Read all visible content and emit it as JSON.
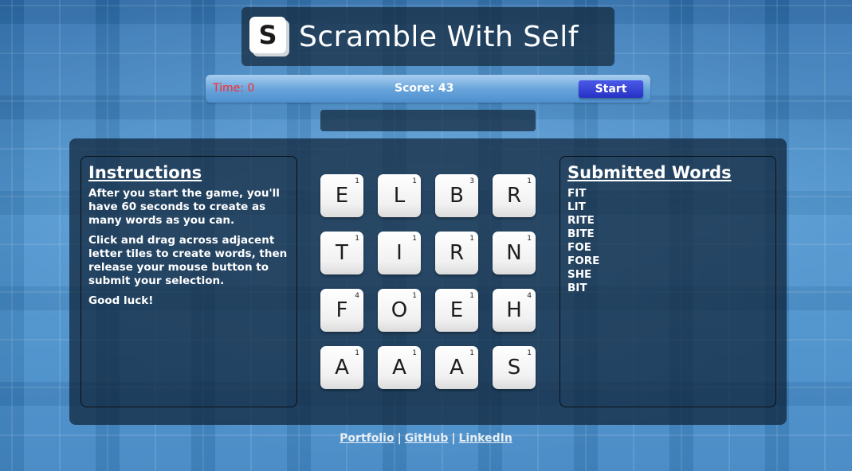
{
  "header": {
    "logo_letter": "S",
    "title": "Scramble With Self"
  },
  "status": {
    "time_label": "Time: 0",
    "score_label": "Score: 43",
    "start_label": "Start"
  },
  "current_word": "",
  "instructions": {
    "heading": "Instructions",
    "paragraphs": [
      "After you start the game, you'll have 60 seconds to create as many words as you can.",
      "Click and drag across adjacent letter tiles to create words, then release your mouse button to submit your selection.",
      "Good luck!"
    ]
  },
  "board": {
    "rows": [
      [
        {
          "letter": "E",
          "points": "1"
        },
        {
          "letter": "L",
          "points": "1"
        },
        {
          "letter": "B",
          "points": "3"
        },
        {
          "letter": "R",
          "points": "1"
        }
      ],
      [
        {
          "letter": "T",
          "points": "1"
        },
        {
          "letter": "I",
          "points": "1"
        },
        {
          "letter": "R",
          "points": "1"
        },
        {
          "letter": "N",
          "points": "1"
        }
      ],
      [
        {
          "letter": "F",
          "points": "4"
        },
        {
          "letter": "O",
          "points": "1"
        },
        {
          "letter": "E",
          "points": "1"
        },
        {
          "letter": "H",
          "points": "4"
        }
      ],
      [
        {
          "letter": "A",
          "points": "1"
        },
        {
          "letter": "A",
          "points": "1"
        },
        {
          "letter": "A",
          "points": "1"
        },
        {
          "letter": "S",
          "points": "1"
        }
      ]
    ]
  },
  "submitted": {
    "heading": "Submitted Words",
    "words": [
      "FIT",
      "LIT",
      "RITE",
      "BITE",
      "FOE",
      "FORE",
      "SHE",
      "BIT"
    ]
  },
  "footer": {
    "links": [
      "Portfolio",
      "GitHub",
      "LinkedIn"
    ],
    "separator": "|"
  }
}
